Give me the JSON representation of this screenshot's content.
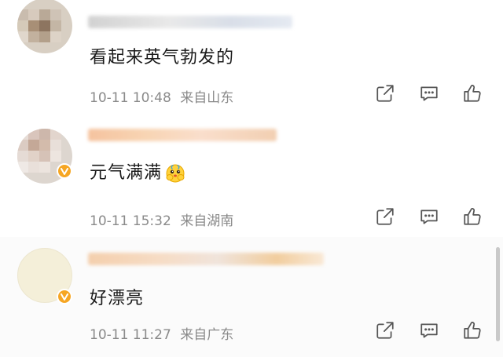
{
  "comments": [
    {
      "text": "看起来英气勃发的",
      "time": "10-11 10:48",
      "location": "来自山东",
      "verified": false
    },
    {
      "text": "元气满满",
      "emoji": "cute-face-emoji",
      "time": "10-11 15:32",
      "location": "来自湖南",
      "verified": true
    },
    {
      "text": "好漂亮",
      "time": "10-11 11:27",
      "location": "来自广东",
      "verified": true
    }
  ],
  "icons": {
    "share": "share-icon",
    "reply": "comment-icon",
    "like": "thumbs-up-icon",
    "badge": "verified-badge-icon"
  },
  "colors": {
    "text": "#1a1a1a",
    "meta": "#8a8a8a",
    "badge": "#f6a623",
    "icon": "#555555"
  }
}
